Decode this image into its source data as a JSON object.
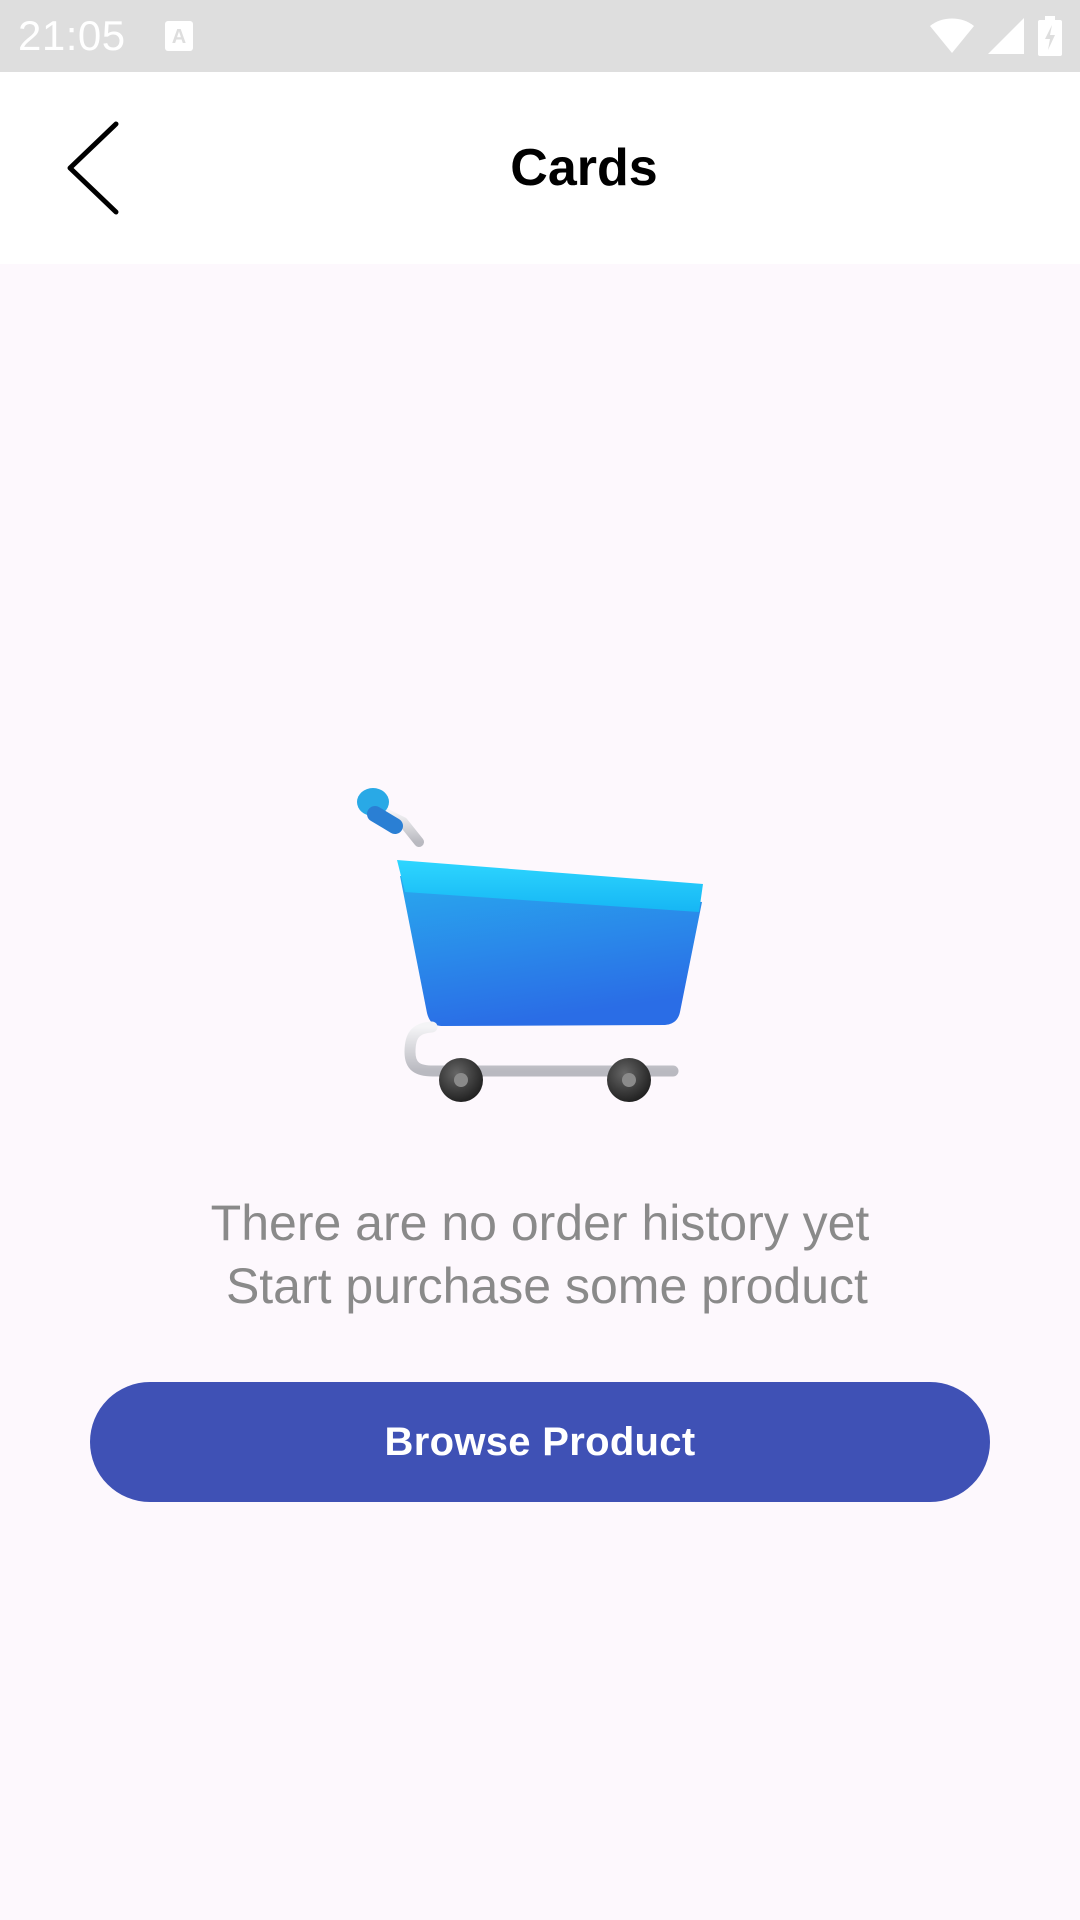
{
  "status_bar": {
    "time": "21:05",
    "icons": [
      "keyboard-a-icon",
      "wifi-icon",
      "signal-icon",
      "battery-charging-icon"
    ]
  },
  "header": {
    "title": "Cards",
    "back_icon": "chevron-left-icon"
  },
  "empty_state": {
    "illustration": "shopping-cart-icon",
    "line1": "There are no order history yet",
    "line2": " Start purchase some product",
    "button_label": "Browse Product"
  },
  "colors": {
    "primary": "#3f51b5",
    "background": "#fdf8fd",
    "message_text": "#8a8a8a",
    "status_bar": "#dedede"
  }
}
